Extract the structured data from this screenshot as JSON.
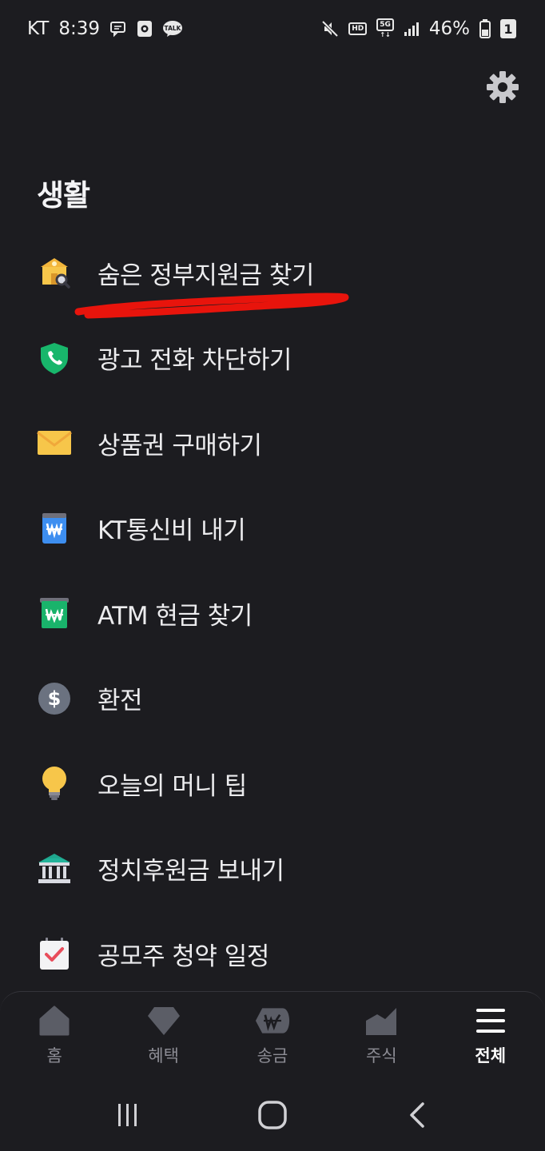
{
  "status_bar": {
    "carrier": "KT",
    "time": "8:39",
    "battery": "46%",
    "sim_badge": "1",
    "hd_badge": "HD",
    "network": "5G",
    "talk_badge": "TALK"
  },
  "settings": {
    "icon": "gear-icon"
  },
  "section": {
    "title": "생활"
  },
  "menu": {
    "items": [
      {
        "label": "숨은 정부지원금 찾기",
        "icon": "government-subsidy-search-icon"
      },
      {
        "label": "광고 전화 차단하기",
        "icon": "phone-shield-icon"
      },
      {
        "label": "상품권 구매하기",
        "icon": "envelope-icon"
      },
      {
        "label": "KT통신비 내기",
        "icon": "won-bill-blue-icon"
      },
      {
        "label": "ATM 현금 찾기",
        "icon": "won-bill-green-icon"
      },
      {
        "label": "환전",
        "icon": "dollar-circle-icon"
      },
      {
        "label": "오늘의 머니 팁",
        "icon": "lightbulb-icon"
      },
      {
        "label": "정치후원금 보내기",
        "icon": "bank-building-icon"
      },
      {
        "label": "공모주 청약 일정",
        "icon": "calendar-check-icon"
      }
    ]
  },
  "bottom_nav": {
    "items": [
      {
        "label": "홈",
        "icon": "home-icon",
        "active": false
      },
      {
        "label": "혜택",
        "icon": "diamond-icon",
        "active": false
      },
      {
        "label": "송금",
        "icon": "won-transfer-icon",
        "active": false
      },
      {
        "label": "주식",
        "icon": "stock-chart-icon",
        "active": false
      },
      {
        "label": "전체",
        "icon": "menu-icon",
        "active": true
      }
    ]
  },
  "system_nav": {
    "recent": "recent-apps-icon",
    "home": "home-circle-icon",
    "back": "back-icon"
  },
  "colors": {
    "background": "#1c1c20",
    "annotation_red": "#e8140c",
    "active_nav": "#ffffff",
    "inactive_nav": "#8d8d95"
  }
}
